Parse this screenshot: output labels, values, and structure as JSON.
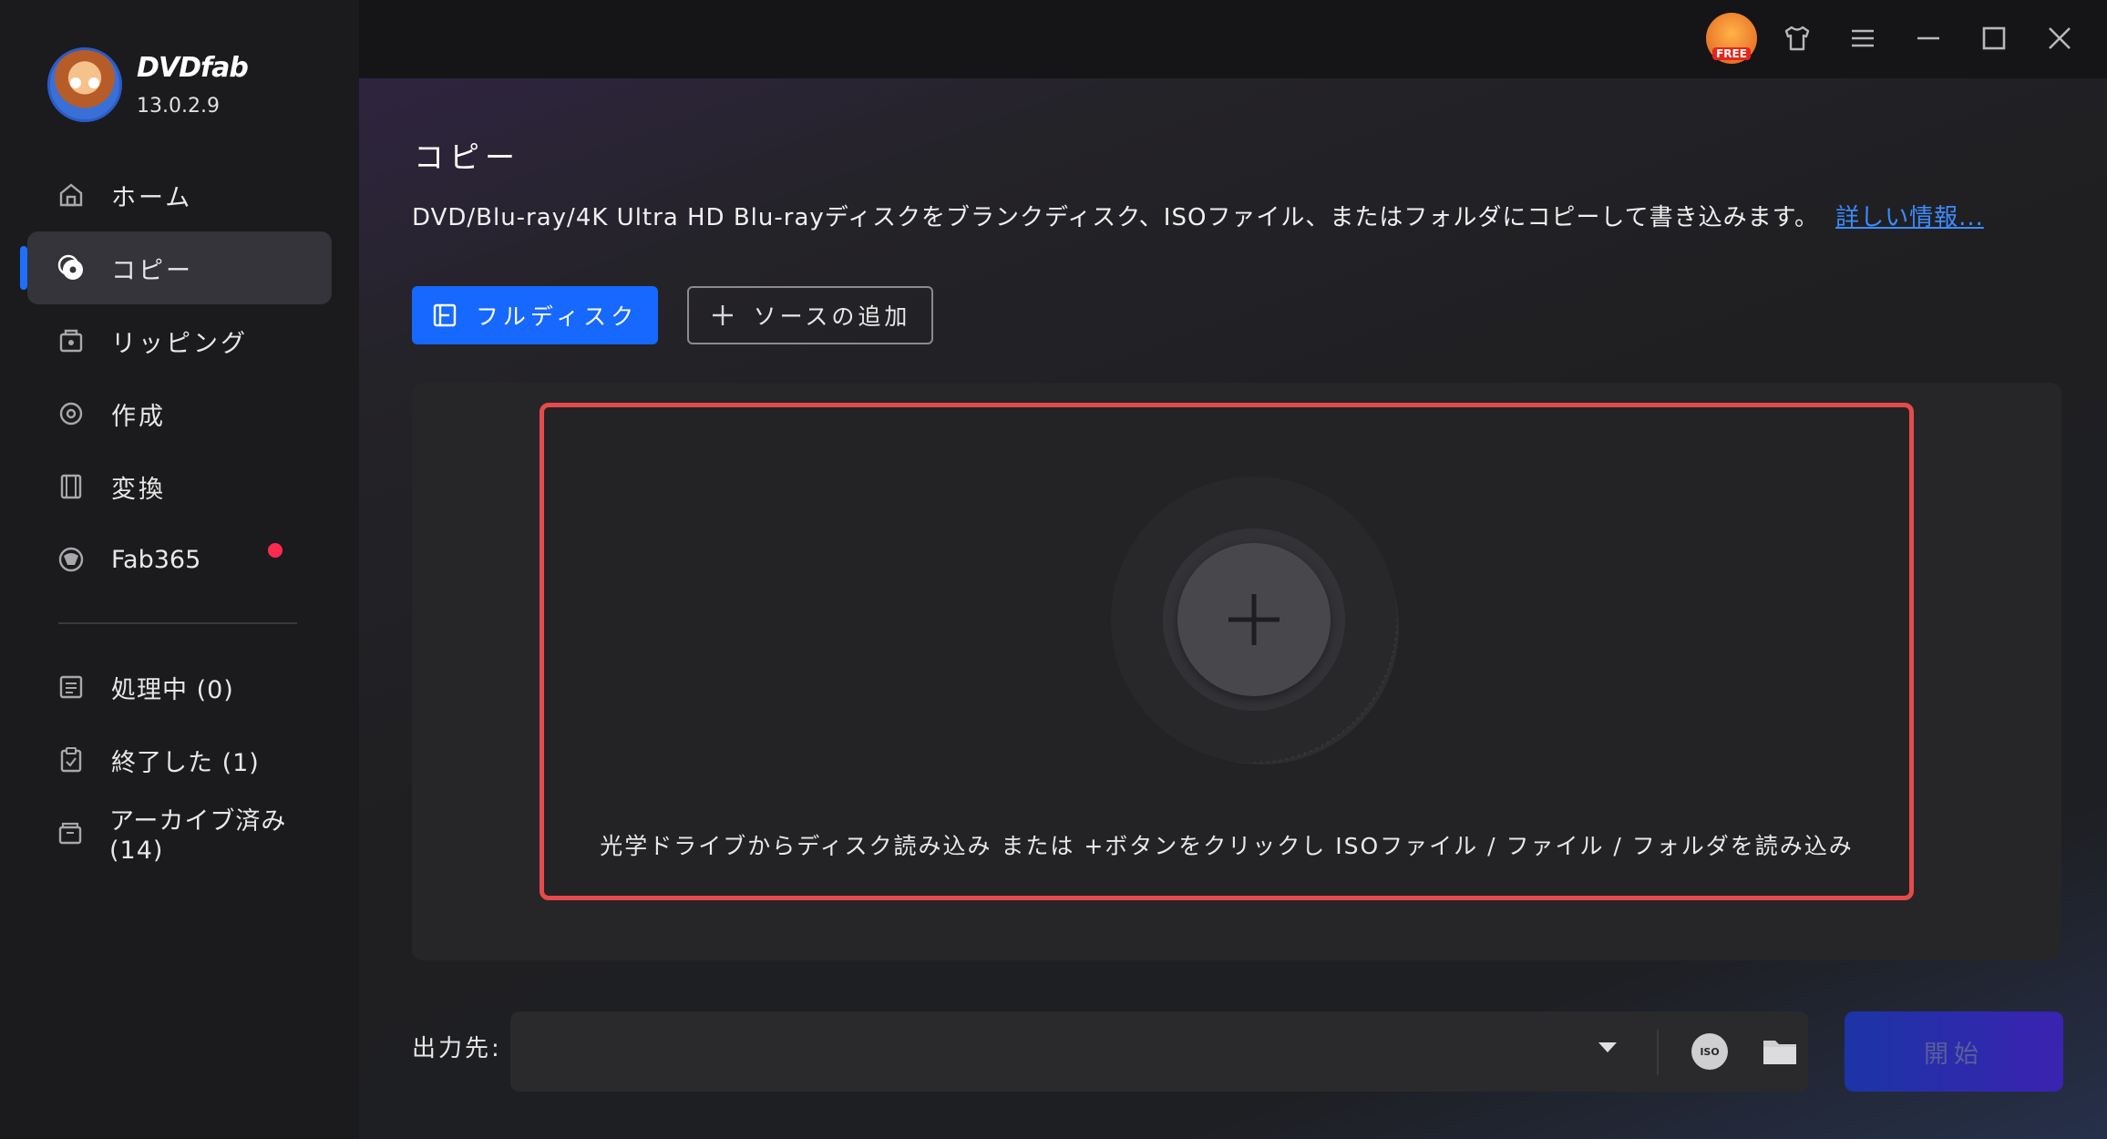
{
  "app": {
    "brand": "DVDfab",
    "version": "13.0.2.9"
  },
  "titlebar": {
    "free_badge": "FREE",
    "icons": [
      "free-gift-icon",
      "shirt-icon",
      "menu-icon",
      "minimize-icon",
      "maximize-icon",
      "close-icon"
    ]
  },
  "sidebar": {
    "items": [
      {
        "label": "ホーム",
        "icon": "home-icon"
      },
      {
        "label": "コピー",
        "icon": "copy-disc-icon",
        "active": true
      },
      {
        "label": "リッピング",
        "icon": "ripping-icon"
      },
      {
        "label": "作成",
        "icon": "create-disc-icon"
      },
      {
        "label": "変換",
        "icon": "film-icon"
      },
      {
        "label": "Fab365",
        "icon": "fab365-icon",
        "notification_dot": true
      }
    ],
    "tasks": [
      {
        "label": "処理中 (0)",
        "icon": "processing-icon"
      },
      {
        "label": "終了した (1)",
        "icon": "finished-icon"
      },
      {
        "label": "アーカイブ済み (14)",
        "icon": "archive-icon"
      }
    ]
  },
  "main": {
    "title": "コピー",
    "description": "DVD/Blu-ray/4K Ultra HD Blu-rayディスクをブランクディスク、ISOファイル、またはフォルダにコピーして書き込みます。",
    "more_link": "詳しい情報...",
    "mode_button": "フルディスク",
    "add_source_button": "ソースの追加",
    "drop_hint": "光学ドライブからディスク読み込み または +ボタンをクリックし ISOファイル / ファイル / フォルダを読み込み",
    "output_label": "出力先:",
    "output_value": "",
    "iso_label": "ISO",
    "start_button": "開始"
  },
  "colors": {
    "accent": "#1668ff",
    "highlight_border": "#e74a4a",
    "notification": "#ff2a4d",
    "link": "#3d8bff"
  }
}
